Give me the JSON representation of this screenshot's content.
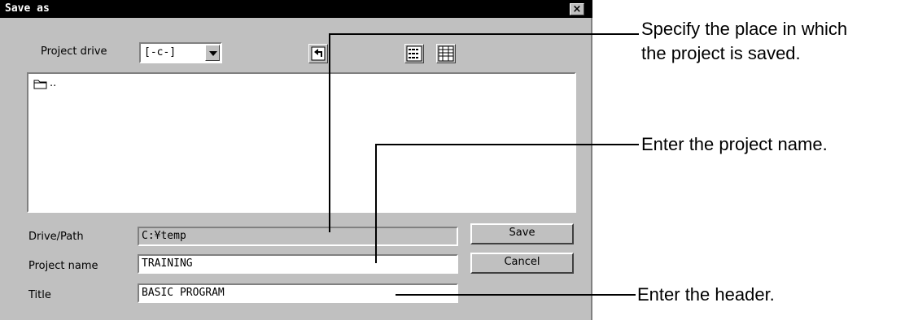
{
  "dialog": {
    "title": "Save as",
    "close_glyph": "×",
    "project_drive_label": "Project drive",
    "project_drive_value": "[-c-]",
    "toolbar_icons": [
      "parent-folder-icon",
      "list-view-icon",
      "details-view-icon"
    ],
    "list_items": [
      ".."
    ],
    "drive_path_label": "Drive/Path",
    "drive_path_value": "C:¥temp",
    "project_name_label": "Project name",
    "project_name_value": "TRAINING",
    "title_label": "Title",
    "title_value": "BASIC PROGRAM",
    "save_label": "Save",
    "cancel_label": "Cancel"
  },
  "annotations": {
    "place_line1": "Specify the place in which",
    "place_line2": "the project is saved.",
    "project_name": "Enter the project name.",
    "header": "Enter the header."
  }
}
